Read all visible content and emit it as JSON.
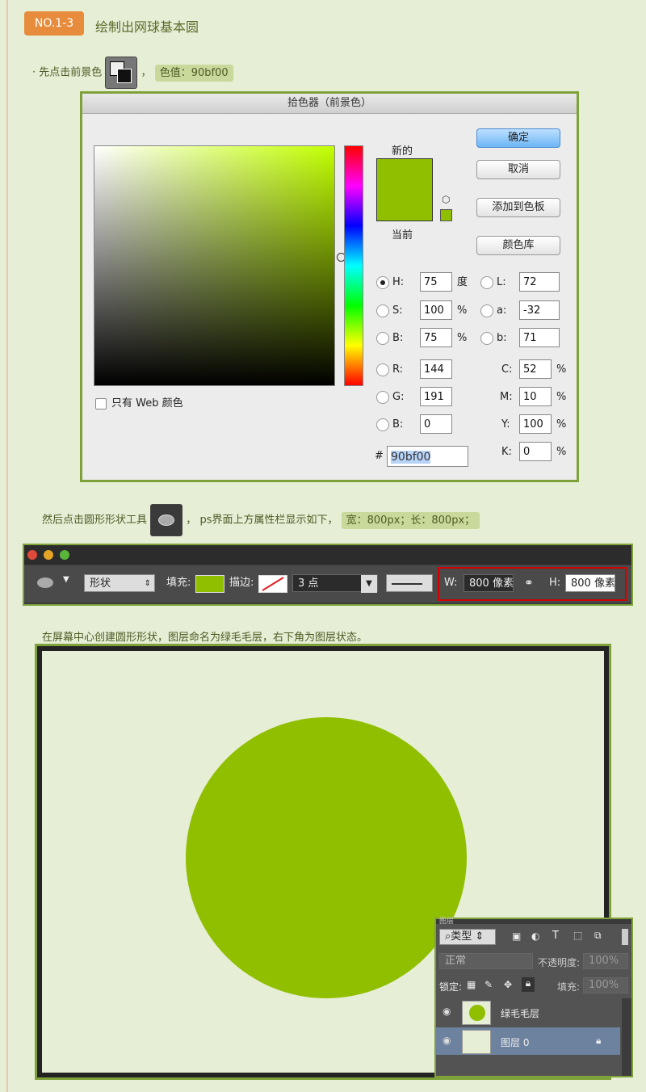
{
  "header": {
    "badge": "NO.1-3",
    "title": "绘制出网球基本圆"
  },
  "step1": {
    "text": "· 先点击前景色",
    "sep": "，",
    "value_label": "色值：90bf00"
  },
  "picker": {
    "title": "拾色器（前景色）",
    "new_label": "新的",
    "current_label": "当前",
    "buttons": {
      "ok": "确定",
      "cancel": "取消",
      "add_swatch": "添加到色板",
      "library": "颜色库"
    },
    "web_only": "只有 Web 颜色",
    "hsb": [
      {
        "label": "H:",
        "value": "75",
        "unit": "度"
      },
      {
        "label": "S:",
        "value": "100",
        "unit": "%"
      },
      {
        "label": "B:",
        "value": "75",
        "unit": "%"
      }
    ],
    "lab": [
      {
        "label": "L:",
        "value": "72"
      },
      {
        "label": "a:",
        "value": "-32"
      },
      {
        "label": "b:",
        "value": "71"
      }
    ],
    "rgb": [
      {
        "label": "R:",
        "value": "144"
      },
      {
        "label": "G:",
        "value": "191"
      },
      {
        "label": "B:",
        "value": "0"
      }
    ],
    "cmyk": [
      {
        "label": "C:",
        "value": "52",
        "unit": "%"
      },
      {
        "label": "M:",
        "value": "10",
        "unit": "%"
      },
      {
        "label": "Y:",
        "value": "100",
        "unit": "%"
      },
      {
        "label": "K:",
        "value": "0",
        "unit": "%"
      }
    ],
    "hex_prefix": "#",
    "hex": "90bf00",
    "color": "#90bf00"
  },
  "step2": {
    "text": "然后点击圆形形状工具",
    "sep": "，",
    "text2": "ps界面上方属性栏显示如下，",
    "value_label": "宽：800px；长：800px；"
  },
  "optbar": {
    "mode": "形状",
    "fill_label": "填充:",
    "stroke_label": "描边:",
    "stroke_size": "3 点",
    "w_label": "W:",
    "w_value": "800 像素",
    "h_label": "H:",
    "h_value": "800 像素"
  },
  "step3": {
    "text": "在屏幕中心创建圆形形状，图层命名为绿毛毛层，右下角为图层状态。"
  },
  "layers": {
    "tab": "图层",
    "filter": "类型",
    "blend": "正常",
    "opacity_label": "不透明度:",
    "opacity": "100%",
    "lock_label": "锁定:",
    "fill_label": "填充:",
    "fill": "100%",
    "items": [
      {
        "name": "绿毛毛层"
      },
      {
        "name": "图层 0"
      }
    ]
  }
}
